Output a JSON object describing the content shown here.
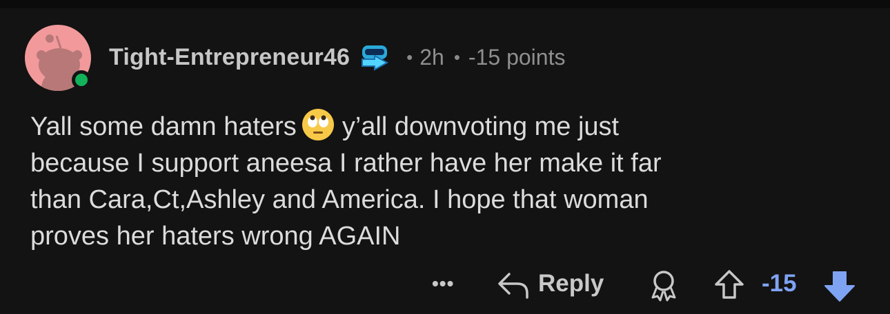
{
  "comment": {
    "username": "Tight-Entrepreneur46",
    "time": "2h",
    "points": "-15 points",
    "separator": "•",
    "body_lines": [
      "Yall some damn haters",
      "y’all downvoting me just",
      "because I support aneesa I rather have her make it far",
      "than Cara,Ct,Ashley and America. I hope that woman",
      "proves her haters wrong AGAIN"
    ],
    "emoji": "face-with-rolling-eyes"
  },
  "actions": {
    "more": "•••",
    "reply": "Reply",
    "score": "-15"
  },
  "colors": {
    "background": "#131313",
    "avatar": "#f2999c",
    "online": "#13b15a",
    "downvote_active": "#7fa3f3"
  },
  "icons": [
    "avatar-snoo-icon",
    "online-status-icon",
    "flair-icon",
    "emoji-rolling-eyes-icon",
    "more-icon",
    "reply-icon",
    "award-icon",
    "upvote-icon",
    "downvote-icon"
  ]
}
